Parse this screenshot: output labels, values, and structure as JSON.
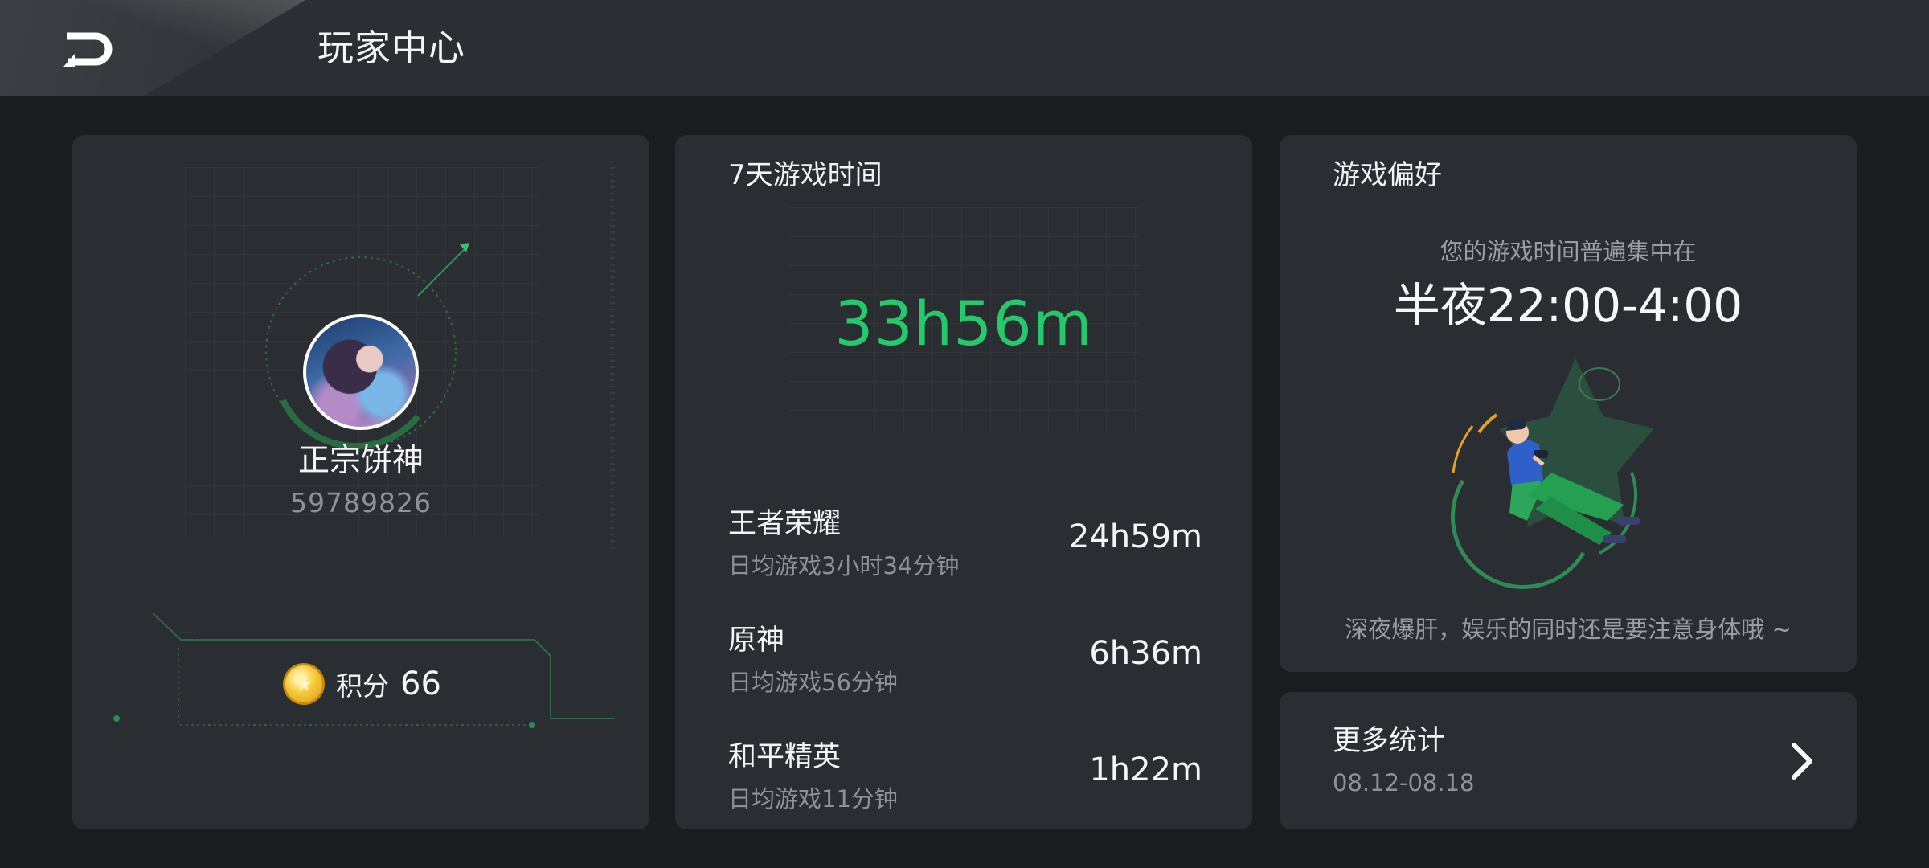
{
  "header": {
    "title": "玩家中心",
    "back_icon": "back-arrow-icon"
  },
  "profile": {
    "nickname": "正宗饼神",
    "uid": "59789826",
    "points_label": "积分",
    "points_value": "66",
    "coin_icon": "star-coin-icon"
  },
  "playtime": {
    "title": "7天游戏时间",
    "total": "33h56m",
    "accent_color": "#25c86a",
    "games": [
      {
        "name": "王者荣耀",
        "avg": "日均游戏3小时34分钟",
        "time": "24h59m"
      },
      {
        "name": "原神",
        "avg": "日均游戏56分钟",
        "time": "6h36m"
      },
      {
        "name": "和平精英",
        "avg": "日均游戏11分钟",
        "time": "1h22m"
      }
    ]
  },
  "preference": {
    "title": "游戏偏好",
    "subtitle": "您的游戏时间普遍集中在",
    "range": "半夜22:00-4:00",
    "tip": "深夜爆肝，娱乐的同时还是要注意身体哦 ~"
  },
  "more_stats": {
    "title": "更多统计",
    "date_range": "08.12-08.18",
    "chevron_icon": "chevron-right-icon"
  }
}
